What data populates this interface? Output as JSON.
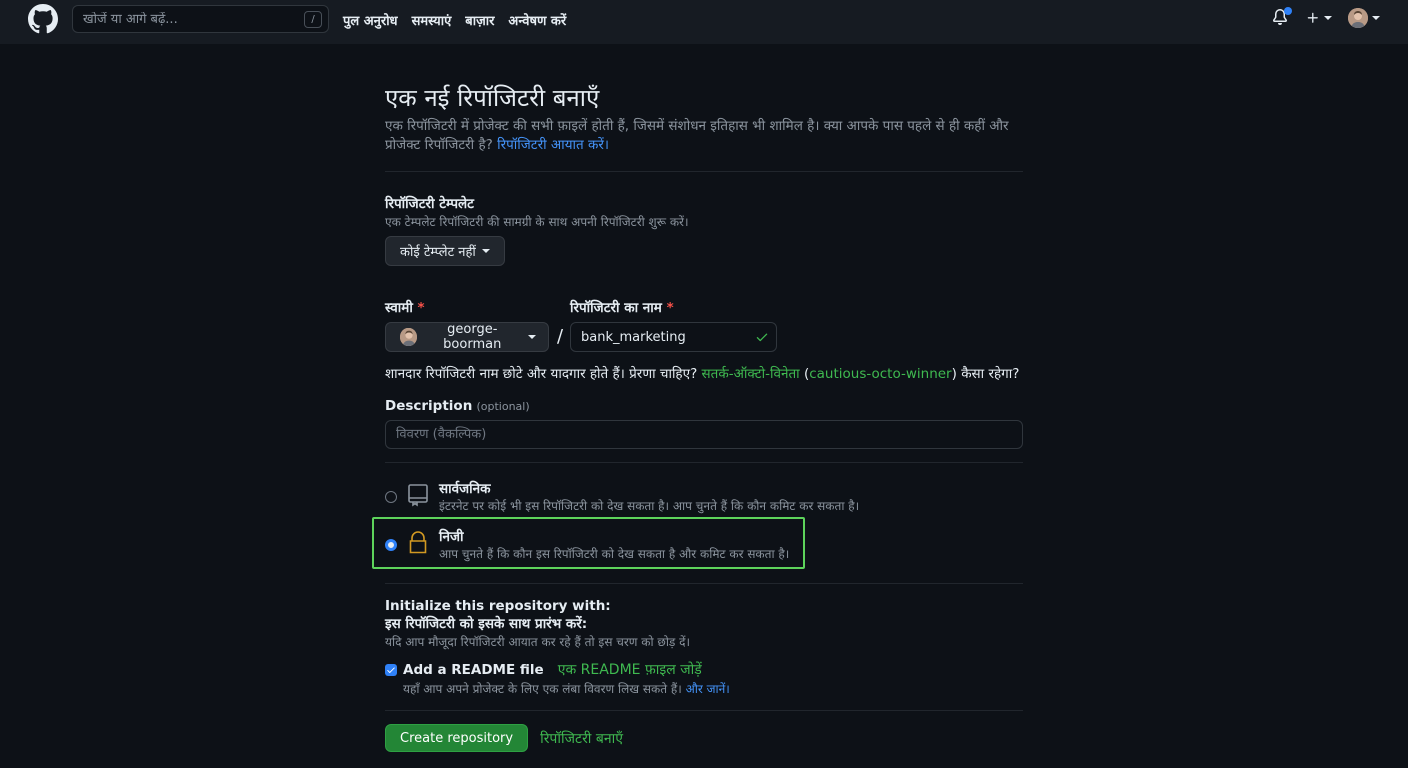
{
  "header": {
    "search_placeholder": "खोजें या आगे बढ़ें...",
    "search_shortcut": "/",
    "nav": [
      "पुल अनुरोध",
      "समस्याएं",
      "बाज़ार",
      "अन्वेषण करें"
    ],
    "notification_dot_color": "#2f81f7"
  },
  "page": {
    "title": "एक नई रिपॉजिटरी बनाएँ",
    "subtitle_text": "एक रिपॉजिटरी में प्रोजेक्ट की सभी फ़ाइलें होती हैं, जिसमें संशोधन इतिहास भी शामिल है। क्या आपके पास पहले से ही कहीं और प्रोजेक्ट रिपॉजिटरी है?",
    "import_link": "रिपॉजिटरी आयात करें।"
  },
  "template": {
    "title": "रिपॉजिटरी टेम्पलेट",
    "hint": "एक टेम्पलेट रिपॉजिटरी की सामग्री के साथ अपनी रिपॉजिटरी शुरू करें।",
    "button_label": "कोई टेम्प्लेट नहीं"
  },
  "owner": {
    "label": "स्वामी",
    "required_mark": "*",
    "value": "george-boorman"
  },
  "repo_name": {
    "label": "रिपॉजिटरी का नाम",
    "required_mark": "*",
    "value": "bank_marketing",
    "separator": "/"
  },
  "suggestion": {
    "text_before": "शानदार रिपॉजिटरी नाम छोटे और यादगार होते हैं। प्रेरणा चाहिए?",
    "suggested_hindi": "सतर्क-ऑक्टो-विनेता",
    "paren_open": "(",
    "suggested_name": "cautious-octo-winner",
    "paren_close": ")",
    "text_after": "कैसा रहेगा?"
  },
  "description": {
    "label": "Description",
    "optional": "(optional)",
    "placeholder": "विवरण (वैकल्पिक)"
  },
  "visibility": {
    "public": {
      "title": "सार्वजनिक",
      "hint": "इंटरनेट पर कोई भी इस रिपॉजिटरी को देख सकता है। आप चुनते हैं कि कौन कमिट कर सकता है।",
      "selected": false
    },
    "private": {
      "title": "निजी",
      "hint": "आप चुनते हैं कि कौन इस रिपॉजिटरी को देख सकता है और कमिट कर सकता है।",
      "selected": true
    },
    "highlight_color": "#5dd35b"
  },
  "initialize": {
    "title_en": "Initialize this repository with:",
    "title_hi": "इस रिपॉजिटरी को इसके साथ प्रारंभ करें:",
    "hint": "यदि आप मौजूदा रिपॉजिटरी आयात कर रहे हैं तो इस चरण को छोड़ दें।",
    "readme_label_en": "Add a README file",
    "readme_label_hi": "एक README फ़ाइल जोड़ें",
    "readme_checked": true,
    "readme_hint": "यहाँ आप अपने प्रोजेक्ट के लिए एक लंबा विवरण लिख सकते हैं।",
    "learn_more": "और जानें।"
  },
  "create": {
    "button_label": "Create repository",
    "label_hi": "रिपॉजिटरी बनाएँ"
  }
}
